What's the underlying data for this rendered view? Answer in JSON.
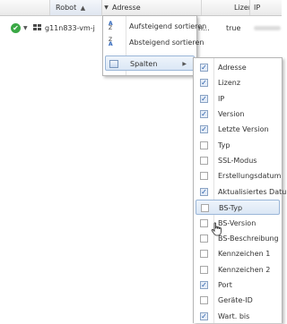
{
  "header": {
    "robot_label": "Robot",
    "robot_sort": "▲",
    "menu_trigger": "▼",
    "adresse_label": "Adresse",
    "lizenz_label": "Lizenz",
    "ip_label": "IP"
  },
  "row": {
    "status_icon": "check-circle-icon",
    "status_glyph": "✔",
    "expand_glyph": "▼",
    "os_icon": "windows-icon",
    "name": "g11n833-vm-j",
    "adresse_partial": "n...",
    "lizenz_value": "true"
  },
  "column_menu": {
    "items": [
      {
        "label": "Aufsteigend sortieren",
        "icon": "sort-ascending-icon"
      },
      {
        "label": "Absteigend sortieren",
        "icon": "sort-descending-icon"
      },
      {
        "label": "Spalten",
        "icon": "columns-icon",
        "submenu_arrow": "▶"
      }
    ]
  },
  "columns_submenu": {
    "items": [
      {
        "label": "Adresse",
        "checked": true
      },
      {
        "label": "Lizenz",
        "checked": true
      },
      {
        "label": "IP",
        "checked": true
      },
      {
        "label": "Version",
        "checked": true
      },
      {
        "label": "Letzte Version",
        "checked": true
      },
      {
        "label": "Typ",
        "checked": false
      },
      {
        "label": "SSL-Modus",
        "checked": false
      },
      {
        "label": "Erstellungsdatum",
        "checked": false
      },
      {
        "label": "Aktualisiertes Datum",
        "checked": true
      },
      {
        "label": "BS-Typ",
        "checked": false,
        "highlighted": true
      },
      {
        "label": "BS-Version",
        "checked": false
      },
      {
        "label": "BS-Beschreibung",
        "checked": false
      },
      {
        "label": "Kennzeichen 1",
        "checked": false
      },
      {
        "label": "Kennzeichen 2",
        "checked": false
      },
      {
        "label": "Port",
        "checked": true
      },
      {
        "label": "Geräte-ID",
        "checked": false
      },
      {
        "label": "Wart. bis",
        "checked": true
      }
    ]
  },
  "colors": {
    "accent": "#1f57a6",
    "status_ok": "#3aa845",
    "highlight_border": "#9ab6d8"
  }
}
